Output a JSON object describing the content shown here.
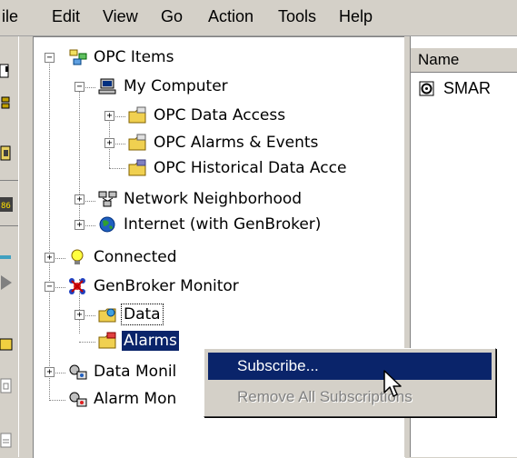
{
  "menubar": {
    "items": [
      "ile",
      "Edit",
      "View",
      "Go",
      "Action",
      "Tools",
      "Help"
    ]
  },
  "tree": {
    "nodes": [
      {
        "label": "OPC Items",
        "expander": "−",
        "icon": "opc-items-icon"
      },
      {
        "label": "My Computer",
        "expander": "−",
        "icon": "computer-icon"
      },
      {
        "label": "OPC Data Access",
        "expander": "+",
        "icon": "folder-icon"
      },
      {
        "label": "OPC Alarms & Events",
        "expander": "+",
        "icon": "folder-icon"
      },
      {
        "label": "OPC Historical Data Acce",
        "expander": "",
        "icon": "folder-icon"
      },
      {
        "label": "Network Neighborhood",
        "expander": "+",
        "icon": "network-icon"
      },
      {
        "label": "Internet (with GenBroker)",
        "expander": "+",
        "icon": "globe-icon"
      },
      {
        "label": "Connected",
        "expander": "+",
        "icon": "lightbulb-icon"
      },
      {
        "label": "GenBroker Monitor",
        "expander": "−",
        "icon": "genbroker-icon"
      },
      {
        "label": "Data",
        "expander": "+",
        "icon": "data-folder-icon"
      },
      {
        "label": "Alarms",
        "expander": "",
        "icon": "alarm-folder-icon"
      },
      {
        "label": "Data Monil",
        "expander": "+",
        "icon": "data-monitor-icon"
      },
      {
        "label": "Alarm Mon",
        "expander": "",
        "icon": "alarm-monitor-icon"
      }
    ]
  },
  "right_pane": {
    "column_header": "Name",
    "items": [
      {
        "label": "SMAR",
        "icon": "server-icon"
      }
    ]
  },
  "context_menu": {
    "items": [
      {
        "label": "Subscribe...",
        "enabled": true,
        "highlighted": true
      },
      {
        "label": "Remove All Subscriptions",
        "enabled": false,
        "highlighted": false
      }
    ]
  },
  "colors": {
    "selection": "#0a246a",
    "window_bg": "#d4d0c8",
    "disabled_text": "#808080"
  }
}
